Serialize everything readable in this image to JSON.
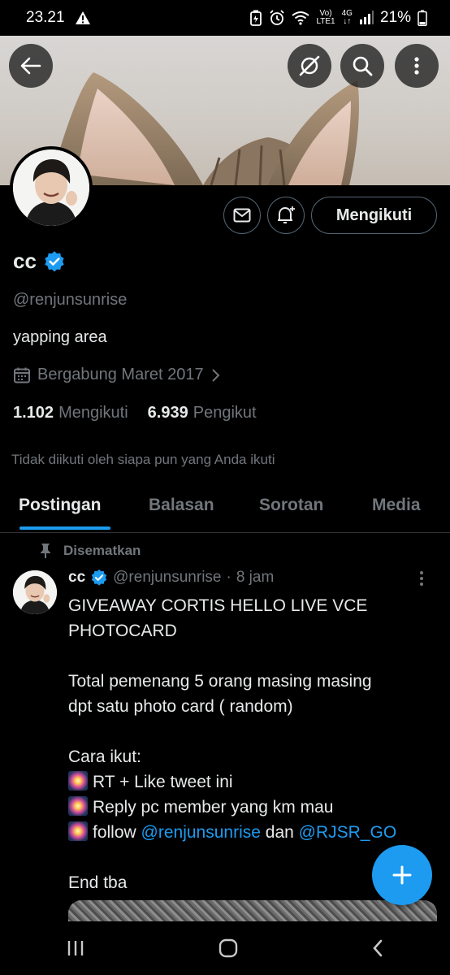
{
  "status_bar": {
    "time": "23.21",
    "volte": "Vo)",
    "lte": "LTE1",
    "network": "4G",
    "battery": "21%"
  },
  "profile": {
    "display_name": "cc",
    "handle": "@renjunsunrise",
    "bio": "yapping area",
    "joined": "Bergabung Maret 2017",
    "following_count": "1.102",
    "following_label": "Mengikuti",
    "followers_count": "6.939",
    "followers_label": "Pengikut",
    "followed_by_note": "Tidak diikuti oleh siapa pun yang Anda ikuti",
    "follow_button_label": "Mengikuti"
  },
  "tabs": [
    {
      "label": "Postingan",
      "active": true
    },
    {
      "label": "Balasan",
      "active": false
    },
    {
      "label": "Sorotan",
      "active": false
    },
    {
      "label": "Media",
      "active": false
    }
  ],
  "post": {
    "pinned_label": "Disematkan",
    "author_name": "cc",
    "author_handle": "@renjunsunrise",
    "separator": "·",
    "time": "8 jam",
    "line1": "GIVEAWAY CORTIS HELLO LIVE VCE",
    "line2": "PHOTOCARD",
    "line3": "Total pemenang 5 orang masing masing",
    "line4": "dpt satu photo card ( random)",
    "line5": "Cara ikut:",
    "line6": "RT + Like tweet ini",
    "line7": "Reply pc member yang km mau",
    "line8_prefix": "follow",
    "line8_mention1": "@renjunsunrise",
    "line8_mid": "dan",
    "line8_mention2": "@RJSR_GO",
    "line9": "End tba"
  },
  "colors": {
    "accent": "#1d9bf0",
    "background": "#000000",
    "text_primary": "#e7e9ea",
    "text_secondary": "#71767b",
    "border": "#2f3336"
  },
  "icons": {
    "back": "arrow-left-icon",
    "grok": "grok-icon",
    "search": "search-icon",
    "more": "more-vertical-icon",
    "message": "envelope-icon",
    "notify": "bell-plus-icon",
    "verified": "verified-badge-icon",
    "calendar": "calendar-icon",
    "pin": "pin-icon",
    "compose": "plus-icon"
  }
}
